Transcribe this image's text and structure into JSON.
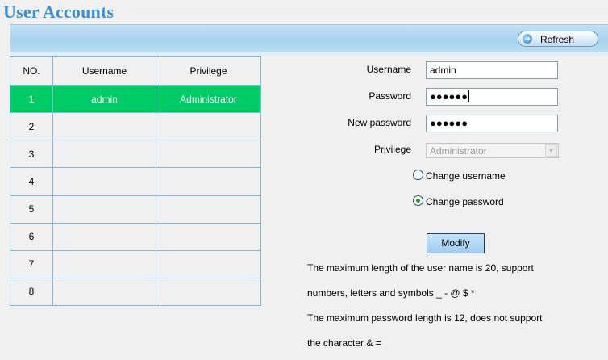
{
  "page": {
    "title": "User Accounts"
  },
  "toolbar": {
    "refresh_label": "Refresh"
  },
  "table": {
    "headers": [
      "NO.",
      "Username",
      "Privilege"
    ],
    "rows": [
      {
        "no": "1",
        "username": "admin",
        "privilege": "Administrator",
        "selected": true
      },
      {
        "no": "2",
        "username": "",
        "privilege": ""
      },
      {
        "no": "3",
        "username": "",
        "privilege": ""
      },
      {
        "no": "4",
        "username": "",
        "privilege": ""
      },
      {
        "no": "5",
        "username": "",
        "privilege": ""
      },
      {
        "no": "6",
        "username": "",
        "privilege": ""
      },
      {
        "no": "7",
        "username": "",
        "privilege": ""
      },
      {
        "no": "8",
        "username": "",
        "privilege": ""
      }
    ],
    "selected_color": "#00cc66"
  },
  "form": {
    "username_label": "Username",
    "username_value": "admin",
    "password_label": "Password",
    "password_value": "●●●●●●",
    "new_password_label": "New password",
    "new_password_value": "●●●●●●",
    "privilege_label": "Privilege",
    "privilege_value": "Administrator",
    "change_username_label": "Change username",
    "change_password_label": "Change password",
    "selected_option": "Change password",
    "modify_label": "Modify"
  },
  "notes": {
    "line1": "The maximum length of the user name is 20, support",
    "line2": "numbers, letters and symbols _ - @ $ *",
    "line3": "The maximum password length is 12, does not support",
    "line4": "the character & ="
  },
  "colors": {
    "title": "#3a8fd6",
    "toolbar": "#a9d3ef",
    "table_border": "#7fb6d9"
  }
}
